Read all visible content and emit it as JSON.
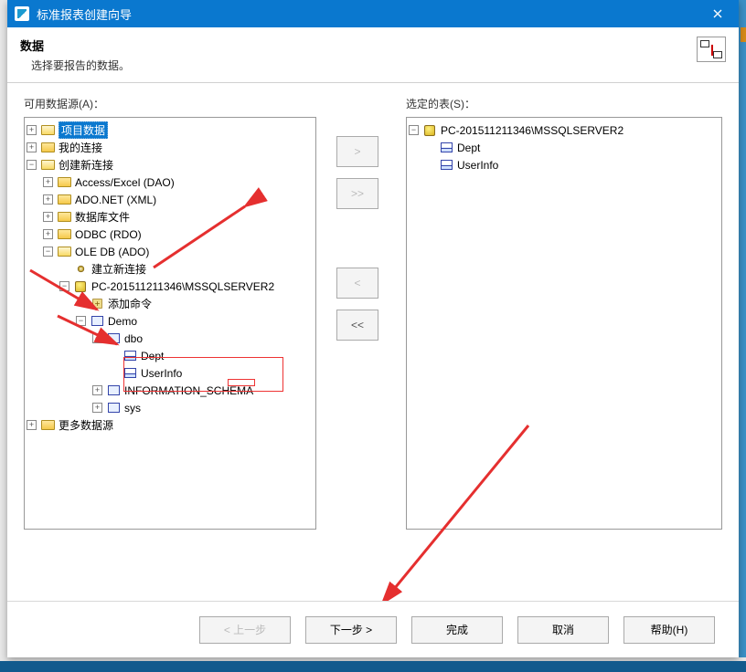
{
  "window": {
    "title": "标准报表创建向导"
  },
  "header": {
    "title": "数据",
    "subtitle": "选择要报告的数据。"
  },
  "left": {
    "label": "可用数据源(A)：",
    "tree": {
      "n0": "项目数据",
      "n1": "我的连接",
      "n2": "创建新连接",
      "n2_0": "Access/Excel (DAO)",
      "n2_1": "ADO.NET (XML)",
      "n2_2": "数据库文件",
      "n2_3": "ODBC (RDO)",
      "n2_4": "OLE DB (ADO)",
      "n2_4_0": "建立新连接",
      "n2_4_1": "PC-201511211346\\MSSQLSERVER2",
      "n2_4_1_0": "添加命令",
      "n2_4_1_1": "Demo",
      "n2_4_1_1_0": "dbo",
      "n2_4_1_1_0_0": "Dept",
      "n2_4_1_1_0_1": "UserInfo",
      "n2_4_1_1_1": "INFORMATION_SCHEMA",
      "n2_4_1_1_2": "sys",
      "n3": "更多数据源"
    }
  },
  "right": {
    "label": "选定的表(S)：",
    "root": "PC-201511211346\\MSSQLSERVER2",
    "t0": "Dept",
    "t1": "UserInfo"
  },
  "mid": {
    "add": ">",
    "addAll": ">>",
    "remove": "<",
    "removeAll": "<<"
  },
  "footer": {
    "back": "< 上一步",
    "next": "下一步 >",
    "finish": "完成",
    "cancel": "取消",
    "help": "帮助(H)"
  }
}
